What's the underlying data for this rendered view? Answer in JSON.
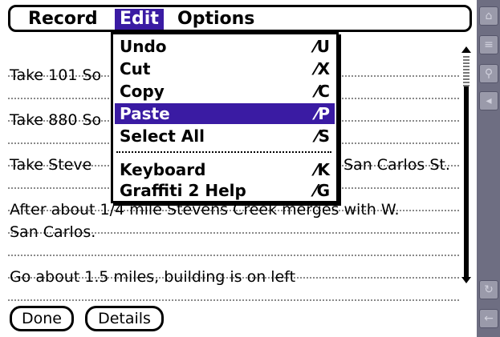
{
  "menubar": {
    "items": [
      {
        "label": "Record"
      },
      {
        "label": "Edit"
      },
      {
        "label": "Options"
      }
    ]
  },
  "dropdown": {
    "items": [
      {
        "label": "Undo",
        "shortcut": "⁄U"
      },
      {
        "label": "Cut",
        "shortcut": "⁄X"
      },
      {
        "label": "Copy",
        "shortcut": "⁄C"
      },
      {
        "label": "Paste",
        "shortcut": "⁄P"
      },
      {
        "label": "Select All",
        "shortcut": "⁄S"
      },
      {
        "label": "Keyboard",
        "shortcut": "⁄K"
      },
      {
        "label": "Graffiti 2 Help",
        "shortcut": "⁄G"
      }
    ]
  },
  "note": {
    "lines": [
      {
        "text": "Take 101 So"
      },
      {
        "text": "Take 880 So"
      },
      {
        "text": "Take Steve"
      },
      {
        "text": "San Carlos St."
      },
      {
        "text": "After about 1/4 mile Stevens Creek merges with W."
      },
      {
        "text": "San Carlos."
      },
      {
        "text": "Go about 1.5 miles, building is on left"
      }
    ]
  },
  "buttons": {
    "done": "Done",
    "details": "Details"
  },
  "colors": {
    "highlight": "#3a1ba3",
    "side_strip": "#6e6e82"
  },
  "icons": {
    "strip": [
      "home-icon",
      "menu-icon",
      "find-icon",
      "speaker-icon",
      "rotate-icon",
      "back-arrow-icon"
    ]
  }
}
